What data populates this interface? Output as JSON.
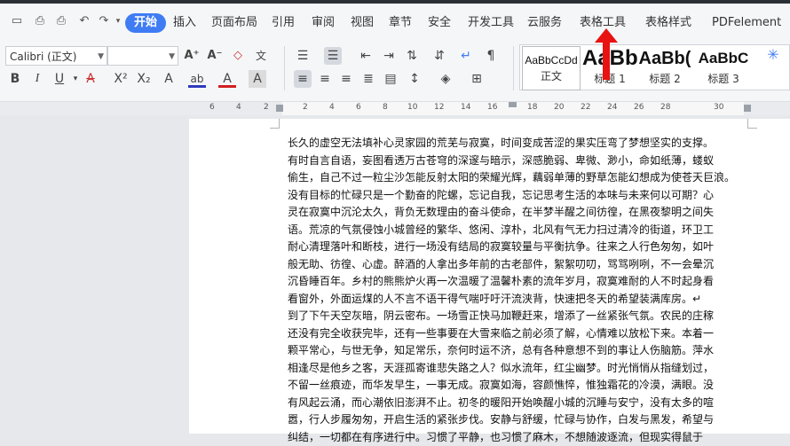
{
  "menubar": {
    "tabs": [
      {
        "label": "开始",
        "active": true
      },
      {
        "label": "插入"
      },
      {
        "label": "页面布局"
      },
      {
        "label": "引用"
      },
      {
        "label": "审阅"
      },
      {
        "label": "视图"
      },
      {
        "label": "章节"
      },
      {
        "label": "安全"
      },
      {
        "label": "开发工具"
      },
      {
        "label": "云服务"
      },
      {
        "label": "表格工具"
      },
      {
        "label": "表格样式"
      },
      {
        "label": "PDFelement"
      }
    ]
  },
  "ribbon": {
    "font_name": "Calibri (正文)",
    "font_size": "",
    "styles": [
      {
        "sample": "AaBbCcDd",
        "caption": "正文"
      },
      {
        "sample": "AaBb",
        "caption": "标题 1"
      },
      {
        "sample": "AaBb(",
        "caption": "标题 2"
      },
      {
        "sample": "AaBbC",
        "caption": "标题 3"
      }
    ]
  },
  "ruler": {
    "numbers": [
      "6",
      "4",
      "2",
      "2",
      "4",
      "6",
      "8",
      "10",
      "12",
      "14",
      "16",
      "18",
      "20",
      "22",
      "24",
      "26",
      "28",
      "30"
    ]
  },
  "document": {
    "lines": [
      "长久的虚空无法填补心灵家园的荒芜与寂寞，时间变成苦涩的果实压弯了梦想坚实的支撑。",
      "有时自言自语，妄图看透万古苍穹的深邃与暗示，深感脆弱、卑微、渺小，命如纸薄，蝼蚁",
      "偷生，自己不过一粒尘沙怎能反射太阳的荣耀光辉，藕弱单薄的野草怎能幻想成为使苍天巨浪。",
      "没有目标的忙碌只是一个勤奋的陀螺，忘记自我，忘记思考生活的本味与未来何以可期？心",
      "灵在寂寞中沉沦太久，背负无数理由的奋斗使命，在半梦半醒之间彷徨，在黑夜黎明之间失",
      "语。荒凉的气氛侵蚀小城曾经的繁华、悠闲、淳朴，北风有气无力扫过清冷的街道，环卫工",
      "耐心清理落叶和断枝，进行一场没有结局的寂寞较量与平衡抗争。往来之人行色匆匆，如叶",
      "般无助、彷徨、心虚。醉酒的人拿出多年前的古老部件，絮絮叨叨，骂骂咧咧，不一会晕沉",
      "沉昏睡百年。乡村的熊熊炉火再一次温暖了温馨朴素的流年岁月，寂寞难耐的人不时起身看",
      "看窗外，外面运煤的人不言不语干得气喘吁吁汗流浃背，快速把冬天的希望装满库房。↵",
      "到了下午天空灰暗，阴云密布。一场雪正快马加鞭赶来，增添了一丝紧张气氛。农民的庄稼",
      "还没有完全收获完毕，还有一些事要在大雪来临之前必须了解，心情难以放松下来。本着一",
      "颗平常心，与世无争，知足常乐，奈何时运不济，总有各种意想不到的事让人伤脑筋。萍水",
      "相逢尽是他乡之客，天涯孤寄谁悲失路之人？似水流年，红尘幽梦。时光悄悄从指缝划过，",
      "不留一丝痕迹，而华发早生，一事无成。寂寞如海，容颜憔悴，惟独霜花的冷漠，满眼。没",
      "有风起云涌，而心潮依旧澎湃不止。初冬的暖阳开始唤醒小城的沉睡与安宁，没有太多的喧",
      "嚣，行人步履匆匆，开启生活的紧张步伐。安静与舒缓，忙碌与协作，白发与黑发，希望与",
      "纠结，一切都在有序进行中。习惯了平静，也习惯了麻木，不想随波逐流，但现实得鼠于"
    ]
  }
}
